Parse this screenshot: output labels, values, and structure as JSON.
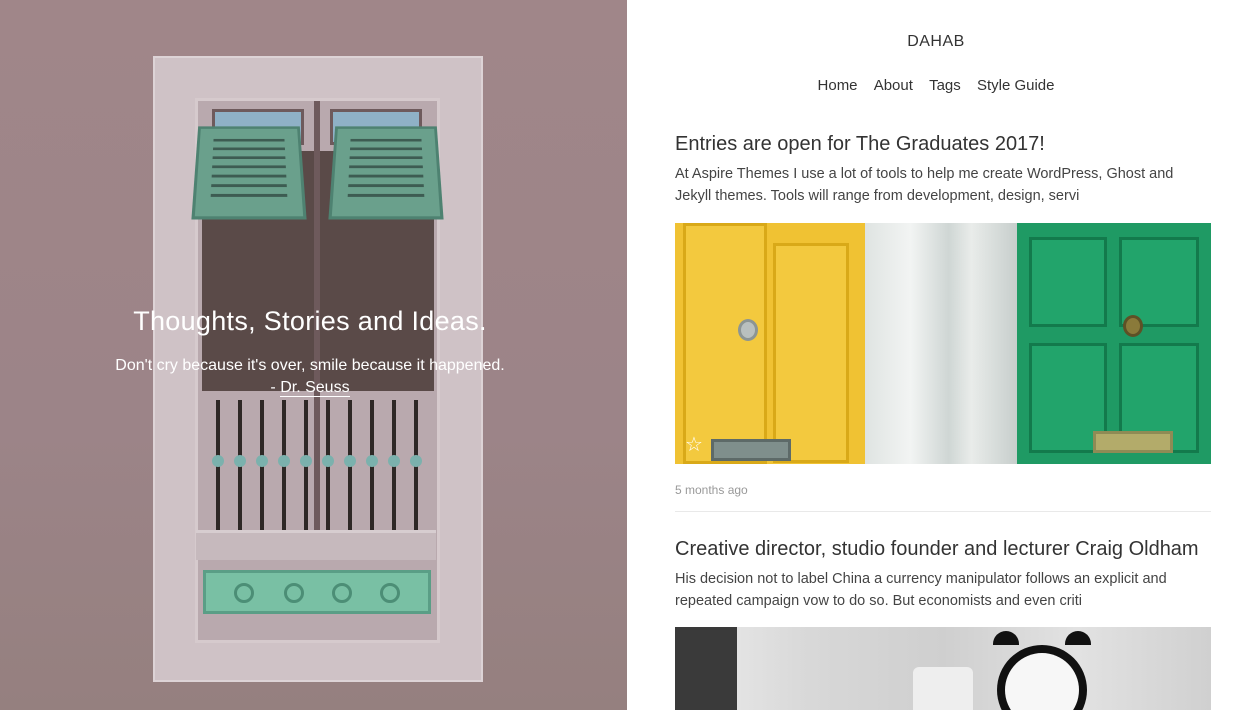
{
  "hero": {
    "title": "Thoughts, Stories and Ideas.",
    "quote": "Don't cry because it's over, smile because it happened.",
    "author_prefix": "- ",
    "author": "Dr. Seuss"
  },
  "site": {
    "logo": "DAHAB"
  },
  "nav": {
    "items": [
      "Home",
      "About",
      "Tags",
      "Style Guide"
    ]
  },
  "posts": [
    {
      "title": "Entries are open for The Graduates 2017!",
      "excerpt": "At Aspire Themes I use a lot of tools to help me create WordPress, Ghost and Jekyll themes. Tools will range from development, design, servi",
      "meta": "5 months ago",
      "featured_icon": "star-icon"
    },
    {
      "title": "Creative director, studio founder and lecturer Craig Oldham",
      "excerpt": "His decision not to label China a currency manipulator follows an explicit and repeated campaign vow to do so. But economists and even criti"
    }
  ],
  "colors": {
    "hero_bg": "#9d8589",
    "text": "#333333",
    "meta": "#999999"
  }
}
